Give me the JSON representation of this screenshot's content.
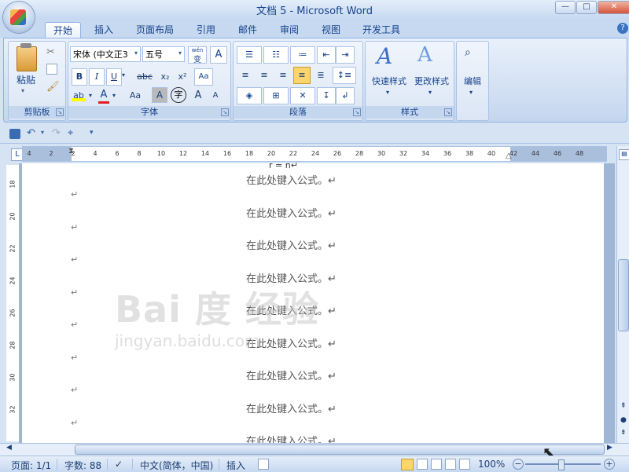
{
  "window": {
    "title": "文档 5 - Microsoft Word",
    "minimize": "—",
    "restore": "□",
    "close": "✕"
  },
  "tabs": [
    "开始",
    "插入",
    "页面布局",
    "引用",
    "邮件",
    "审阅",
    "视图",
    "开发工具"
  ],
  "ribbon": {
    "clipboard": {
      "label": "剪贴板",
      "paste_label": "粘贴"
    },
    "font": {
      "label": "字体",
      "font_name": "宋体 (中文正3",
      "font_size": "五号",
      "bold": "B",
      "italic": "I",
      "underline": "U",
      "strike": "abc",
      "subscript": "x₂",
      "superscript": "x²",
      "wen_label": "wén",
      "wen_char": "变",
      "a_box": "A",
      "case": "Aa",
      "grow": "A",
      "shrink": "A",
      "char_border": "A",
      "enclose": "字"
    },
    "paragraph": {
      "label": "段落"
    },
    "styles": {
      "label": "样式",
      "quick_styles": "快速样式",
      "change_styles": "更改样式"
    },
    "editing": {
      "label": "编辑",
      "edit": "编辑"
    }
  },
  "ruler": {
    "corner": "L",
    "ticks": [
      "4",
      "2",
      "2",
      "4",
      "6",
      "8",
      "10",
      "12",
      "14",
      "16",
      "18",
      "20",
      "22",
      "24",
      "26",
      "28",
      "30",
      "32",
      "34",
      "36",
      "38",
      "40",
      "42",
      "44",
      "46",
      "48"
    ],
    "vticks": [
      "18",
      "20",
      "22",
      "24",
      "26",
      "28",
      "30",
      "32"
    ]
  },
  "document": {
    "formula_text": "在此处键入公式。↵",
    "para_mark": "↵",
    "formula_count": 9,
    "watermark": "Bai 度 经验",
    "watermark_sub": "jingyan.baidu.com"
  },
  "statusbar": {
    "page": "页面: 1/1",
    "words": "字数: 88",
    "language": "中文(简体，中国)",
    "mode": "插入",
    "zoom": "100%"
  },
  "colors": {
    "ribbon_bg": "#d0def2",
    "accent": "#15428b",
    "scroll": "#b7cdec"
  }
}
